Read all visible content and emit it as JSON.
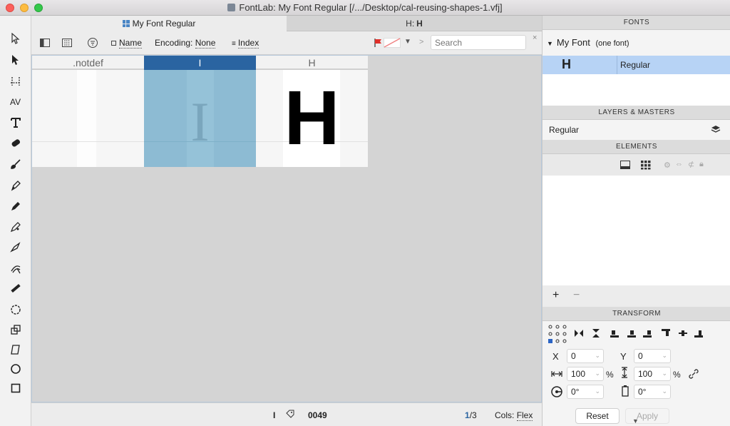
{
  "window": {
    "title": "FontLab: My Font Regular [/.../Desktop/cal-reusing-shapes-1.vfj]"
  },
  "tabs": [
    {
      "label": "My Font Regular",
      "active": true
    },
    {
      "label": "H: ",
      "glyph": "H",
      "active": false
    }
  ],
  "toolbar": {
    "name_label": "Name",
    "encoding_label": "Encoding:",
    "encoding_value": "None",
    "index_label": "Index",
    "arrow_label": ">",
    "search_placeholder": "Search",
    "close_label": "×"
  },
  "glyph_cells": [
    {
      "caption": ".notdef",
      "glyph": "",
      "selected": false
    },
    {
      "caption": "I",
      "glyph": "I",
      "selected": true
    },
    {
      "caption": "H",
      "glyph": "H",
      "selected": false
    }
  ],
  "status": {
    "glyph": "I",
    "code": "0049",
    "page_current": "1",
    "page_total": "/3",
    "cols_label": "Cols:",
    "cols_value": "Flex"
  },
  "fonts_panel": {
    "header": "FONTS",
    "family": "My Font",
    "family_note": "(one font)",
    "style_glyph": "H",
    "style_name": "Regular"
  },
  "layers_panel": {
    "header": "LAYERS & MASTERS",
    "layer": "Regular"
  },
  "elements_panel": {
    "header": "ELEMENTS",
    "add_label": "+",
    "remove_label": "−"
  },
  "transform_panel": {
    "header": "TRANSFORM",
    "x_label": "X",
    "x_value": "0",
    "y_label": "Y",
    "y_value": "0",
    "width_value": "100",
    "width_unit": "%",
    "height_value": "100",
    "height_unit": "%",
    "rotate_value": "0°",
    "slant_value": "0°",
    "reset_label": "Reset",
    "apply_label": "Apply"
  }
}
